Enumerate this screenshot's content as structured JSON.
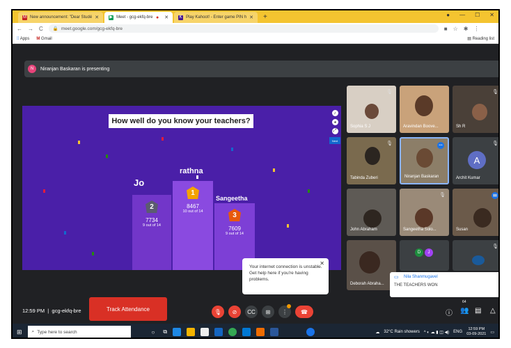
{
  "browser": {
    "tabs": [
      {
        "label": "New announcement: \"Dear Studé",
        "color": "#c5221f"
      },
      {
        "label": "Meet - gcg-ekfq-bre",
        "color": "#0f9d58"
      },
      {
        "label": "Play Kahoot! - Enter game PIN h",
        "color": "#46178f"
      }
    ],
    "url": "meet.google.com/gcg-ekfq-bre",
    "bookmarks": [
      "Apps",
      "Gmail"
    ],
    "reading_list": "Reading list"
  },
  "meet": {
    "presenter_initial": "N",
    "presenting_text": "Niranjan Baskaran is presenting",
    "meeting_time": "12:59 PM",
    "meeting_code": "gcg-ekfq-bre",
    "track_attendance": "Track Attendance",
    "participant_count": "64"
  },
  "kahoot": {
    "question": "How well do you know your teachers?",
    "next_label": "Next",
    "podium": [
      {
        "name": "Jo",
        "rank": "2",
        "points": "7734",
        "sub": "9 out of 14",
        "badge_color": "#5b5b70"
      },
      {
        "name": "rathna",
        "rank": "1",
        "points": "8467",
        "sub": "10 out of 14",
        "badge_color": "#f4a300"
      },
      {
        "name": "Sangeetha",
        "rank": "3",
        "points": "7609",
        "sub": "9 out of 14",
        "badge_color": "#e8590c"
      }
    ]
  },
  "participants": [
    {
      "name": "Sophia S J"
    },
    {
      "name": "Aravindan Boove..."
    },
    {
      "name": "Sh R"
    },
    {
      "name": "Tabinda Zuberi"
    },
    {
      "name": "Niranjan Baskaran"
    },
    {
      "name": "Archit Kumar",
      "initial": "A"
    },
    {
      "name": "John Abraham"
    },
    {
      "name": "Sangeetha Solo..."
    },
    {
      "name": "Susan"
    },
    {
      "name": "Deborah Abraha..."
    },
    {
      "name": "",
      "initials": [
        "D",
        "J"
      ]
    },
    {
      "name": ""
    }
  ],
  "toast": {
    "text": "Your internet connection is unstable. Get help here if you're having problems."
  },
  "chat_popup": {
    "sender": "Nila Shanmugavel",
    "message": "THE TEACHERS WON"
  },
  "taskbar": {
    "search_placeholder": "Type here to search",
    "weather": "32°C  Rain showers",
    "lang": "ENG",
    "time": "12:59 PM",
    "date": "03-09-2021"
  }
}
